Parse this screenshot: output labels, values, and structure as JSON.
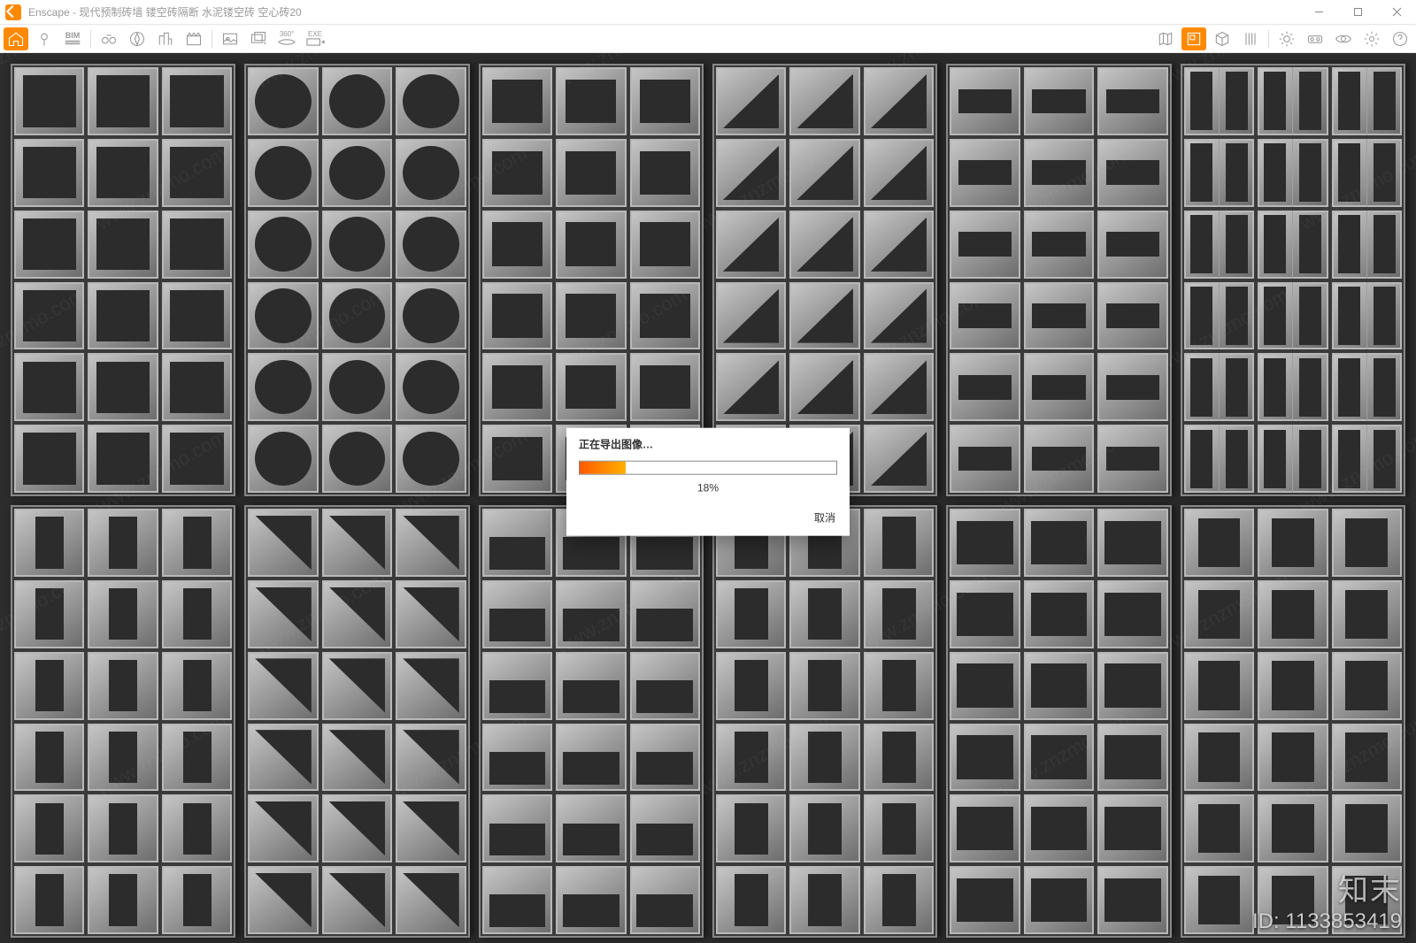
{
  "app": {
    "name": "Enscape",
    "title_sep": " - ",
    "document_title": "现代预制砖墙 镂空砖隔断 水泥镂空砖 空心砖20"
  },
  "window_controls": {
    "minimize": "–",
    "maximize": "▢",
    "close": "✕"
  },
  "toolbar": {
    "left": [
      {
        "name": "home-icon",
        "active": true
      },
      {
        "name": "pin-icon",
        "active": false
      },
      {
        "name": "bim-icon",
        "active": false,
        "label": "BIM"
      },
      {
        "name": "binoculars-icon",
        "active": false
      },
      {
        "name": "compass-icon",
        "active": false
      },
      {
        "name": "buildings-icon",
        "active": false
      },
      {
        "name": "clapper-icon",
        "active": false
      },
      {
        "name": "screenshot-icon",
        "active": false
      },
      {
        "name": "batch-render-icon",
        "active": false
      },
      {
        "name": "pano-360-icon",
        "active": false,
        "label": "360°"
      },
      {
        "name": "export-exe-icon",
        "active": false,
        "label": "EXE"
      }
    ],
    "right": [
      {
        "name": "map-icon"
      },
      {
        "name": "minimap-icon",
        "active": true
      },
      {
        "name": "box-icon"
      },
      {
        "name": "curtain-icon"
      },
      {
        "name": "sun-icon"
      },
      {
        "name": "vr-icon"
      },
      {
        "name": "eye-icon"
      },
      {
        "name": "settings-icon"
      },
      {
        "name": "help-icon"
      }
    ]
  },
  "viewport": {
    "panels": [
      "square",
      "circle",
      "beveled",
      "triangle",
      "hslot",
      "triple",
      "vslot",
      "diag",
      "lowslot",
      "narrow",
      "wide",
      "double"
    ]
  },
  "dialog": {
    "title": "正在导出图像…",
    "progress_percent": 18,
    "progress_label": "18%",
    "cancel": "取消"
  },
  "watermark": {
    "brand": "知末",
    "id_label": "ID: 1133853419",
    "pattern_text": "www.znzmo.com"
  }
}
